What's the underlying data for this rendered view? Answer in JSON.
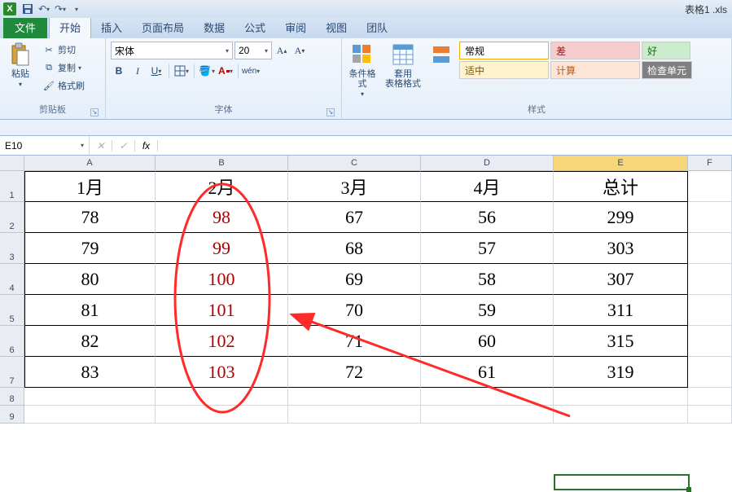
{
  "title_filename": "表格1 .xls",
  "qat": {
    "save_icon": "save",
    "undo_icon": "undo",
    "redo_icon": "redo"
  },
  "tabs": {
    "file": "文件",
    "home": "开始",
    "insert": "插入",
    "layout": "页面布局",
    "data": "数据",
    "formulas": "公式",
    "review": "审阅",
    "view": "视图",
    "team": "团队"
  },
  "clipboard": {
    "paste": "粘贴",
    "cut": "剪切",
    "copy": "复制",
    "format_painter": "格式刷",
    "group_label": "剪贴板"
  },
  "font": {
    "name": "宋体",
    "size": "20",
    "bold": "B",
    "italic": "I",
    "underline": "U",
    "group_label": "字体"
  },
  "cond_format": "条件格式",
  "table_format": "套用\n表格格式",
  "quick_styles": {
    "normal": "常规",
    "bad": "差",
    "good": "好",
    "neutral": "适中",
    "calc": "计算",
    "check": "检查单元",
    "group_label": "样式"
  },
  "namebox": "E10",
  "fx_label": "fx",
  "columns": [
    "A",
    "B",
    "C",
    "D",
    "E",
    "F"
  ],
  "row_numbers": [
    "1",
    "2",
    "3",
    "4",
    "5",
    "6",
    "7",
    "8",
    "9"
  ],
  "sheet": {
    "headers": [
      "1月",
      "2月",
      "3月",
      "4月",
      "总计"
    ],
    "rows": [
      [
        "78",
        "98",
        "67",
        "56",
        "299"
      ],
      [
        "79",
        "99",
        "68",
        "57",
        "303"
      ],
      [
        "80",
        "100",
        "69",
        "58",
        "307"
      ],
      [
        "81",
        "101",
        "70",
        "59",
        "311"
      ],
      [
        "82",
        "102",
        "71",
        "60",
        "315"
      ],
      [
        "83",
        "103",
        "72",
        "61",
        "319"
      ]
    ]
  },
  "chart_data": {
    "type": "table",
    "columns": [
      "1月",
      "2月",
      "3月",
      "4月",
      "总计"
    ],
    "rows": [
      [
        78,
        98,
        67,
        56,
        299
      ],
      [
        79,
        99,
        68,
        57,
        303
      ],
      [
        80,
        100,
        69,
        58,
        307
      ],
      [
        81,
        101,
        70,
        59,
        311
      ],
      [
        82,
        102,
        71,
        60,
        315
      ],
      [
        83,
        103,
        72,
        61,
        319
      ]
    ]
  }
}
